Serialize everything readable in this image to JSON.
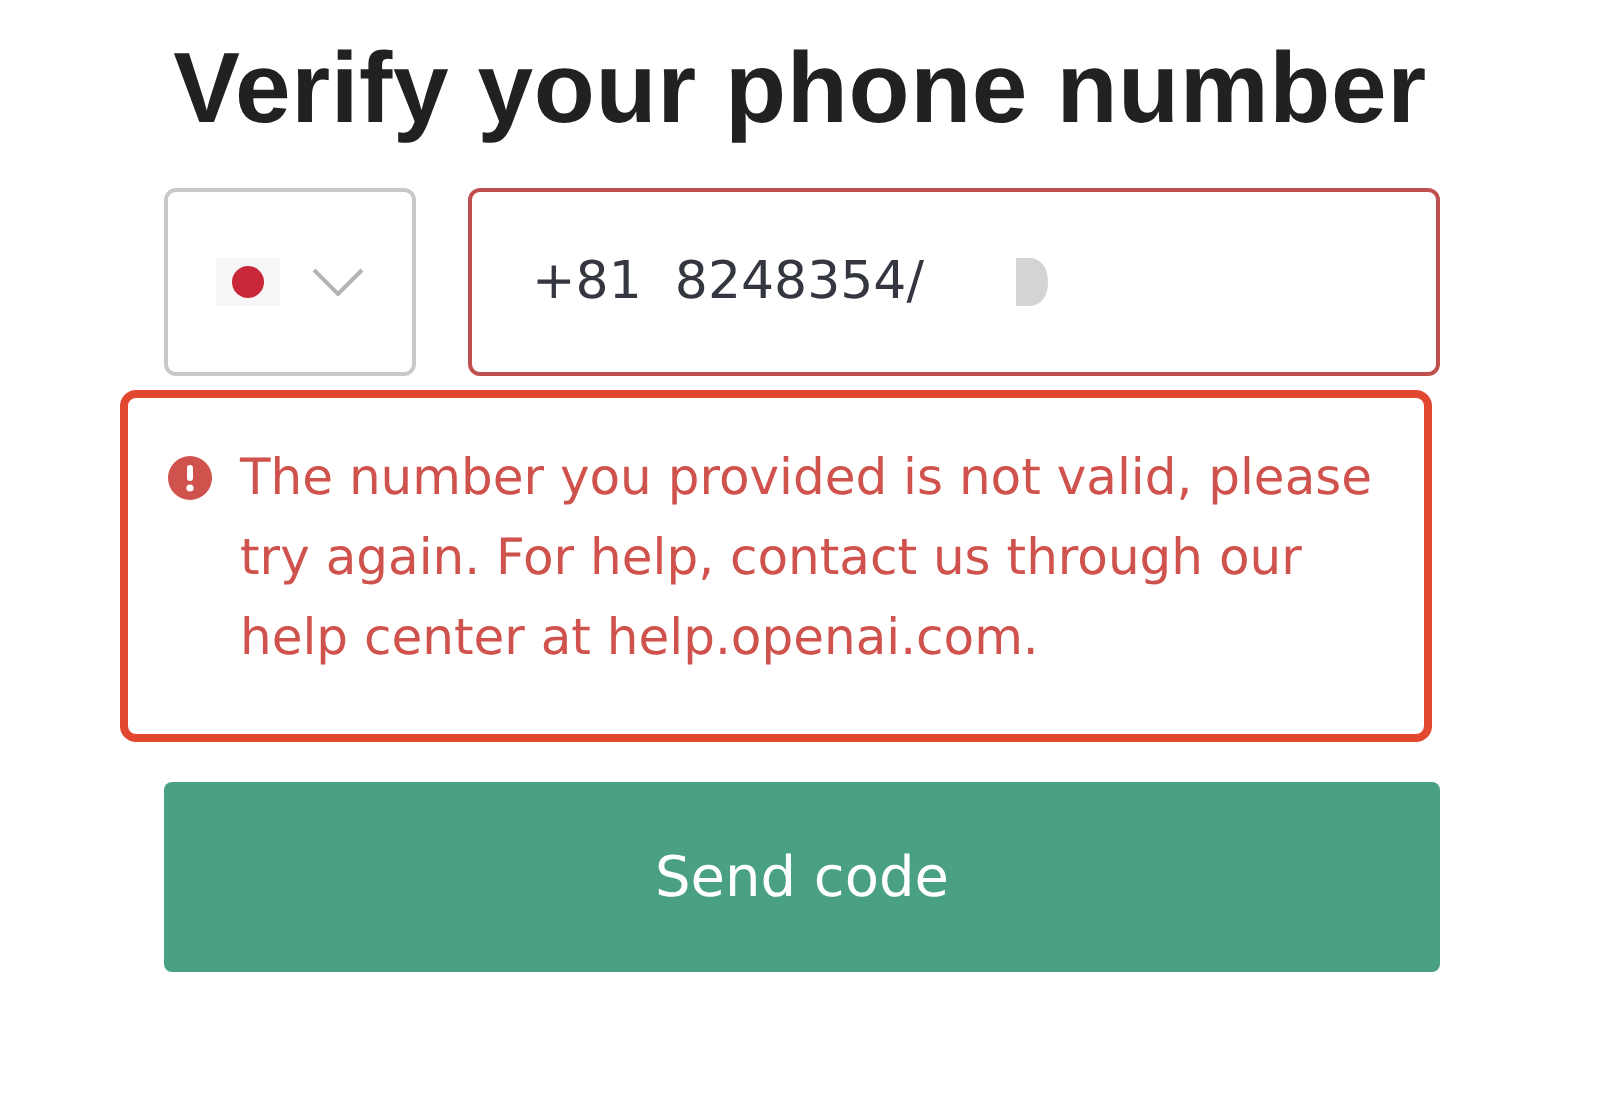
{
  "title": "Verify your phone number",
  "country_select": {
    "expanded": false
  },
  "phone_field": {
    "value": "+81  8248354/",
    "invalid": true
  },
  "error": {
    "message": "The number you provided is not valid, please try again. For help, contact us through our help center at help.openai.com."
  },
  "submit_button": {
    "label": "Send code"
  }
}
